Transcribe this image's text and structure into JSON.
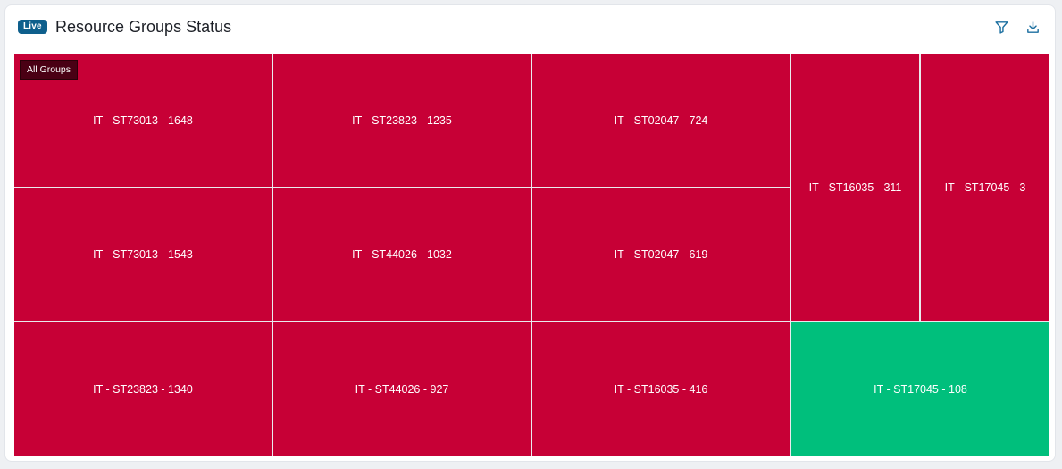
{
  "header": {
    "badge": "Live",
    "title": "Resource Groups Status",
    "icons": [
      "filter-icon",
      "download-icon"
    ]
  },
  "treemap": {
    "breadcrumb": "All Groups",
    "tiles": [
      {
        "label": "IT - ST73013 - 1648",
        "status": "critical"
      },
      {
        "label": "IT - ST23823 - 1235",
        "status": "critical"
      },
      {
        "label": "IT - ST02047 - 724",
        "status": "critical"
      },
      {
        "label": "IT - ST16035 - 311",
        "status": "critical"
      },
      {
        "label": "IT - ST17045 - 3",
        "status": "critical"
      },
      {
        "label": "IT - ST73013 - 1543",
        "status": "critical"
      },
      {
        "label": "IT - ST44026 - 1032",
        "status": "critical"
      },
      {
        "label": "IT - ST02047 - 619",
        "status": "critical"
      },
      {
        "label": "IT - ST23823 - 1340",
        "status": "critical"
      },
      {
        "label": "IT - ST44026 - 927",
        "status": "critical"
      },
      {
        "label": "IT - ST16035 - 416",
        "status": "critical"
      },
      {
        "label": "IT - ST17045 - 108",
        "status": "ok"
      }
    ]
  },
  "colors": {
    "critical": "#c70036",
    "ok": "#00bf7c",
    "badge": "#0e5f8c",
    "icon": "#1b6fa0"
  }
}
